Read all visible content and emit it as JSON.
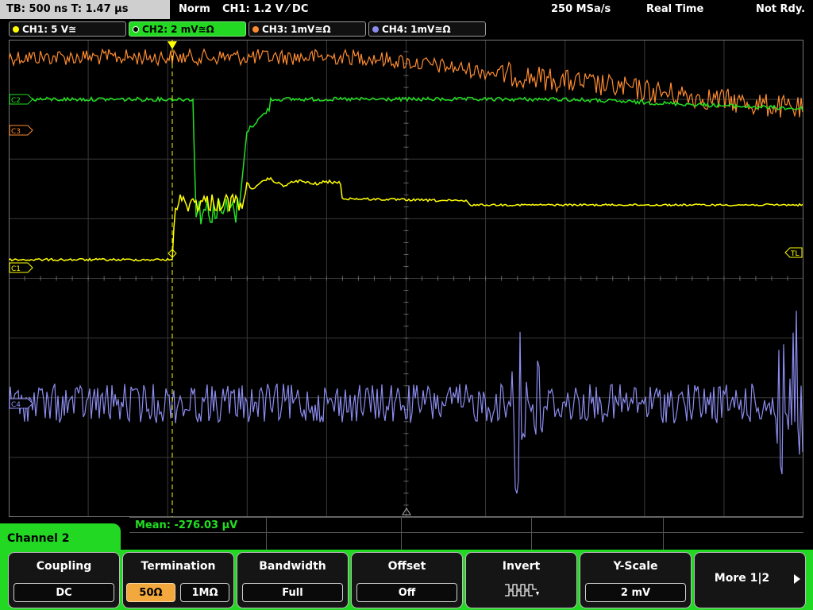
{
  "topbar": {
    "timebase": "TB: 500 ns   T: 1.47 µs",
    "mode": "Norm",
    "trigger": "CH1: 1.2 V ⁄ DC",
    "sample_rate": "250 MSa/s",
    "acq": "Real Time",
    "status": "Not Rdy."
  },
  "channels": [
    {
      "label": "CH1: 5 V≅",
      "color": "#ffff00"
    },
    {
      "label": "CH2: 2 mV≅Ω",
      "color": "#22d822"
    },
    {
      "label": "CH3: 1mV≅Ω",
      "color": "#ff8c30"
    },
    {
      "label": "CH4: 1mV≅Ω",
      "color": "#8c8cf0"
    }
  ],
  "markers": {
    "c3": "C3",
    "c2": "C2",
    "c1": "C1",
    "c4": "C4",
    "trigger_level": "TL"
  },
  "measurement": {
    "text": "Mean: -276.03 µV"
  },
  "menu": {
    "channel_title": "Channel 2",
    "coupling": {
      "title": "Coupling",
      "value": "DC"
    },
    "termination": {
      "title": "Termination",
      "opt1": "50Ω",
      "opt2": "1MΩ"
    },
    "bandwidth": {
      "title": "Bandwidth",
      "value": "Full"
    },
    "offset": {
      "title": "Offset",
      "value": "Off"
    },
    "invert": {
      "title": "Invert"
    },
    "yscale": {
      "title": "Y-Scale",
      "value": "2 mV"
    },
    "more": "More 1|2"
  }
}
